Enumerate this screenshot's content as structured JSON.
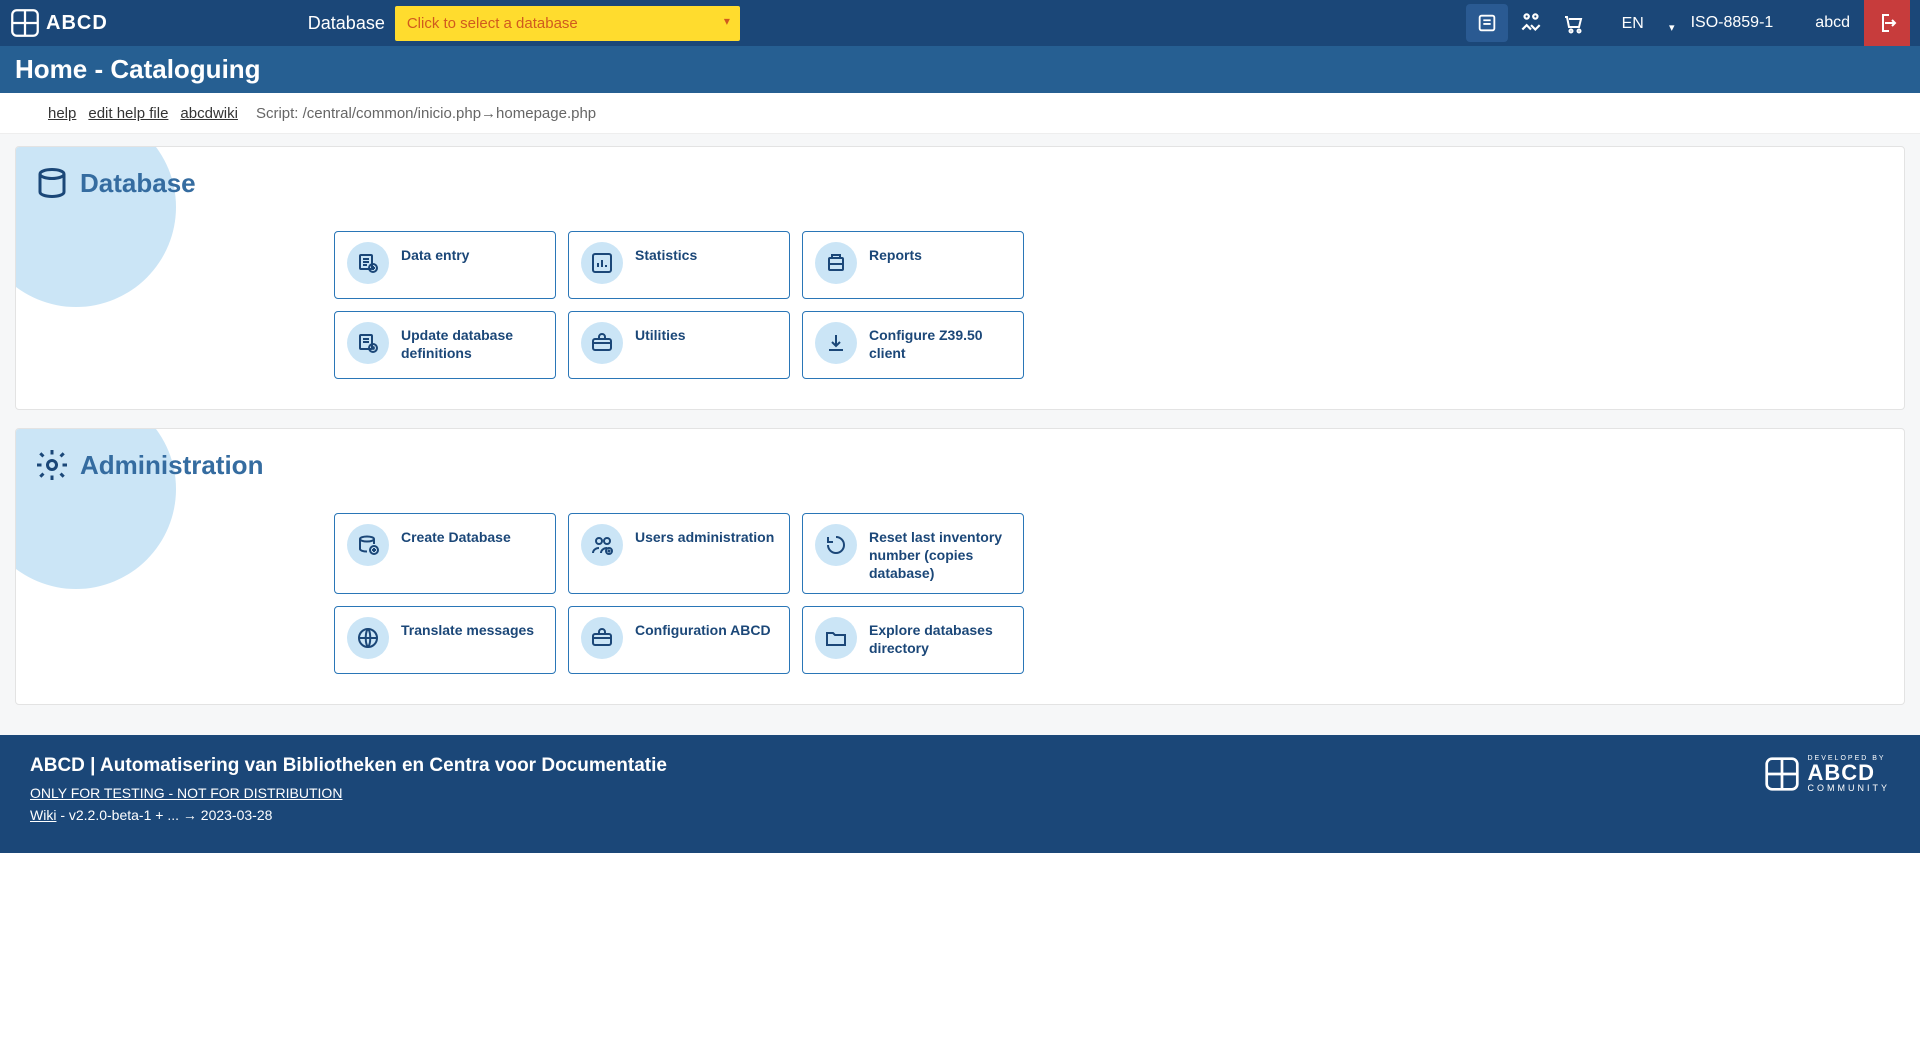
{
  "header": {
    "logo_text": "ABCD",
    "database_label": "Database",
    "database_placeholder": "Click to select a database",
    "language": "EN",
    "encoding": "ISO-8859-1",
    "username": "abcd"
  },
  "page_title": "Home - Cataloguing",
  "helpbar": {
    "help": "help",
    "edit_help": "edit help file",
    "wiki": "abcdwiki",
    "script": "Script: /central/common/inicio.php→homepage.php"
  },
  "sections": {
    "database": {
      "title": "Database",
      "cards": [
        {
          "label": "Data entry",
          "icon": "data-entry"
        },
        {
          "label": "Statistics",
          "icon": "statistics"
        },
        {
          "label": "Reports",
          "icon": "reports"
        },
        {
          "label": "Update database definitions",
          "icon": "update-db"
        },
        {
          "label": "Utilities",
          "icon": "utilities"
        },
        {
          "label": "Configure Z39.50 client",
          "icon": "download"
        }
      ]
    },
    "administration": {
      "title": "Administration",
      "cards": [
        {
          "label": "Create Database",
          "icon": "create-db"
        },
        {
          "label": "Users administration",
          "icon": "users"
        },
        {
          "label": "Reset last inventory number (copies database)",
          "icon": "reset"
        },
        {
          "label": "Translate messages",
          "icon": "globe"
        },
        {
          "label": "Configuration ABCD",
          "icon": "toolbox"
        },
        {
          "label": "Explore databases directory",
          "icon": "folder"
        }
      ]
    }
  },
  "footer": {
    "title": "ABCD | Automatisering van Bibliotheken en Centra voor Documentatie",
    "disclaimer": "ONLY FOR TESTING - NOT FOR DISTRIBUTION",
    "wiki_label": "Wiki",
    "version": " - v2.2.0-beta-1 + ... → 2023-03-28",
    "community": "DEVELOPED BY",
    "community2": "ABCD",
    "community3": "COMMUNITY"
  }
}
